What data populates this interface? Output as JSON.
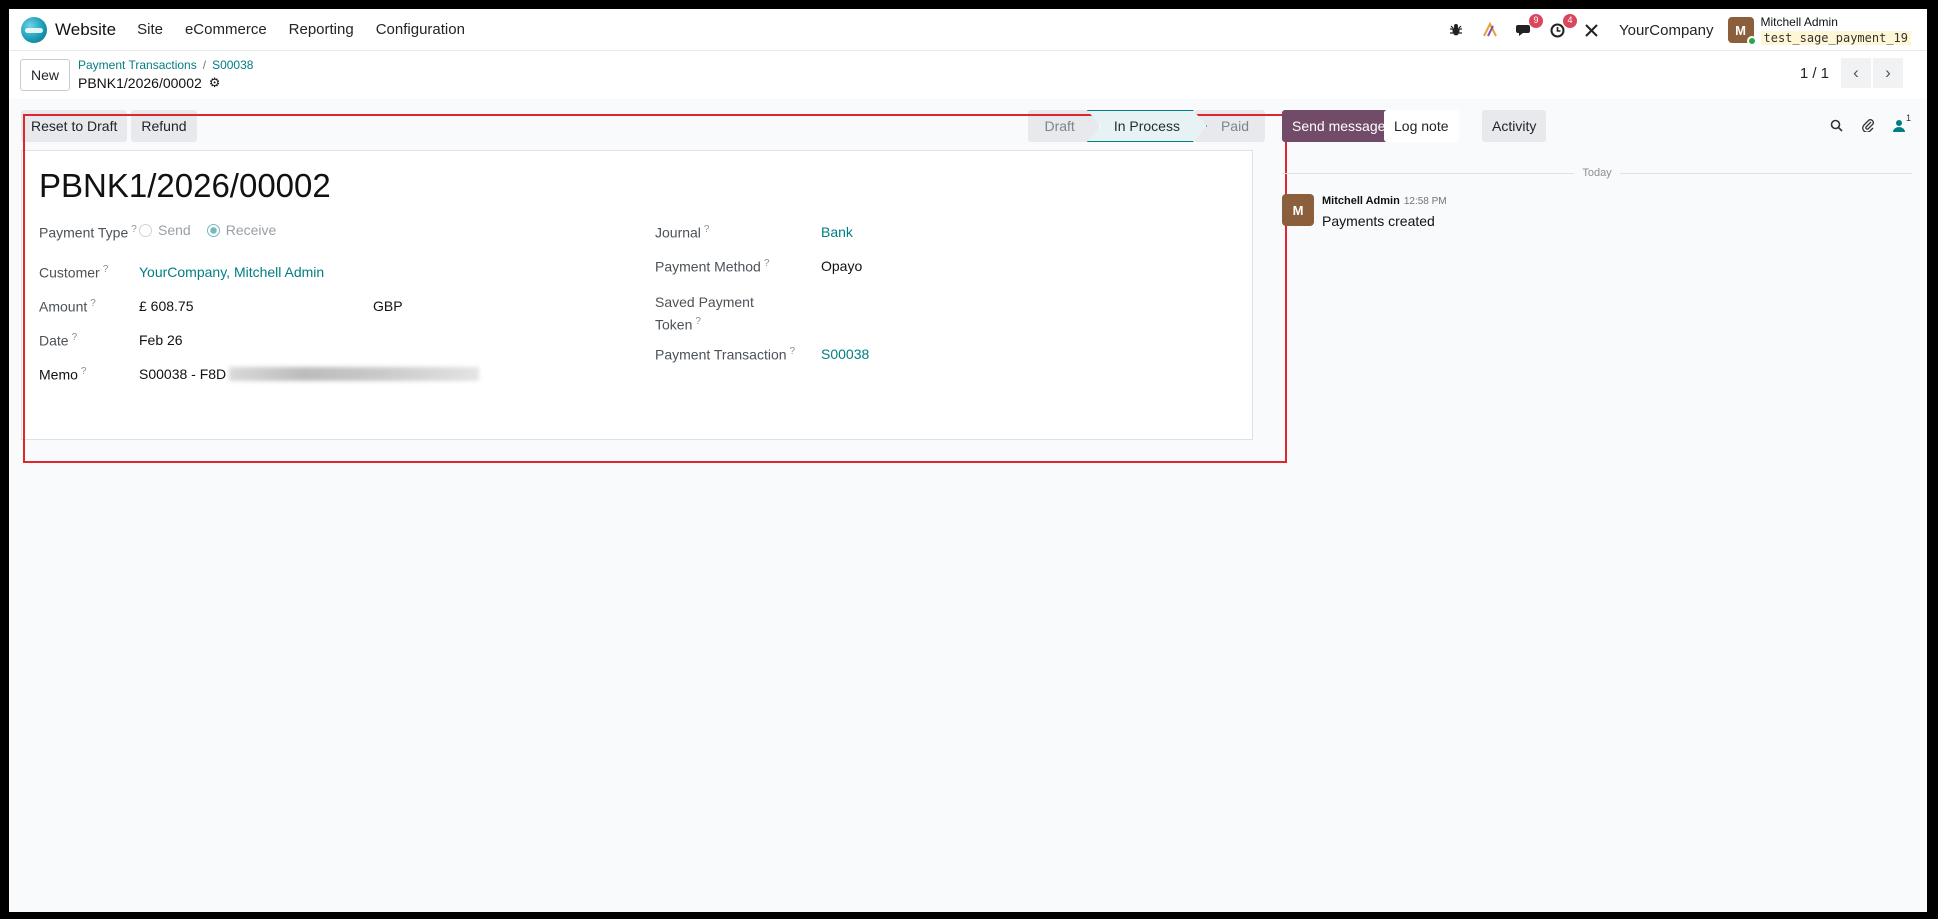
{
  "navbar": {
    "app_name": "Website",
    "menu": [
      "Site",
      "eCommerce",
      "Reporting",
      "Configuration"
    ],
    "messages_count": "9",
    "activities_count": "4",
    "company": "YourCompany",
    "user_name": "Mitchell Admin",
    "db_name": "test_sage_payment_19"
  },
  "control": {
    "new_label": "New",
    "breadcrumb": [
      "Payment Transactions",
      "S00038"
    ],
    "record_name": "PBNK1/2026/00002",
    "pager_value": "1 / 1"
  },
  "statusbar": {
    "reset_label": "Reset to Draft",
    "refund_label": "Refund",
    "stages": [
      "Draft",
      "In Process",
      "Paid"
    ],
    "active_stage": "In Process"
  },
  "form": {
    "title": "PBNK1/2026/00002",
    "payment_type_label": "Payment Type",
    "payment_type_options": [
      "Send",
      "Receive"
    ],
    "payment_type_selected": "Receive",
    "customer_label": "Customer",
    "customer_value": "YourCompany, Mitchell Admin",
    "amount_label": "Amount",
    "amount_value": "£ 608.75",
    "currency_value": "GBP",
    "date_label": "Date",
    "date_value": "Feb 26",
    "memo_label": "Memo",
    "memo_value": "S00038 - F8D",
    "journal_label": "Journal",
    "journal_value": "Bank",
    "payment_method_label": "Payment Method",
    "payment_method_value": "Opayo",
    "saved_token_label_1": "Saved Payment",
    "saved_token_label_2": "Token",
    "payment_transaction_label": "Payment Transaction",
    "payment_transaction_value": "S00038",
    "help_mark": "?"
  },
  "chatter": {
    "send_message_label": "Send message",
    "log_note_label": "Log note",
    "activity_label": "Activity",
    "followers_count": "1",
    "date_separator": "Today",
    "message_author": "Mitchell Admin",
    "message_time": "12:58 PM",
    "message_body": "Payments created"
  },
  "colors": {
    "accent": "#017e84",
    "primary_button": "#714b67",
    "highlight_border": "#e0252b"
  }
}
